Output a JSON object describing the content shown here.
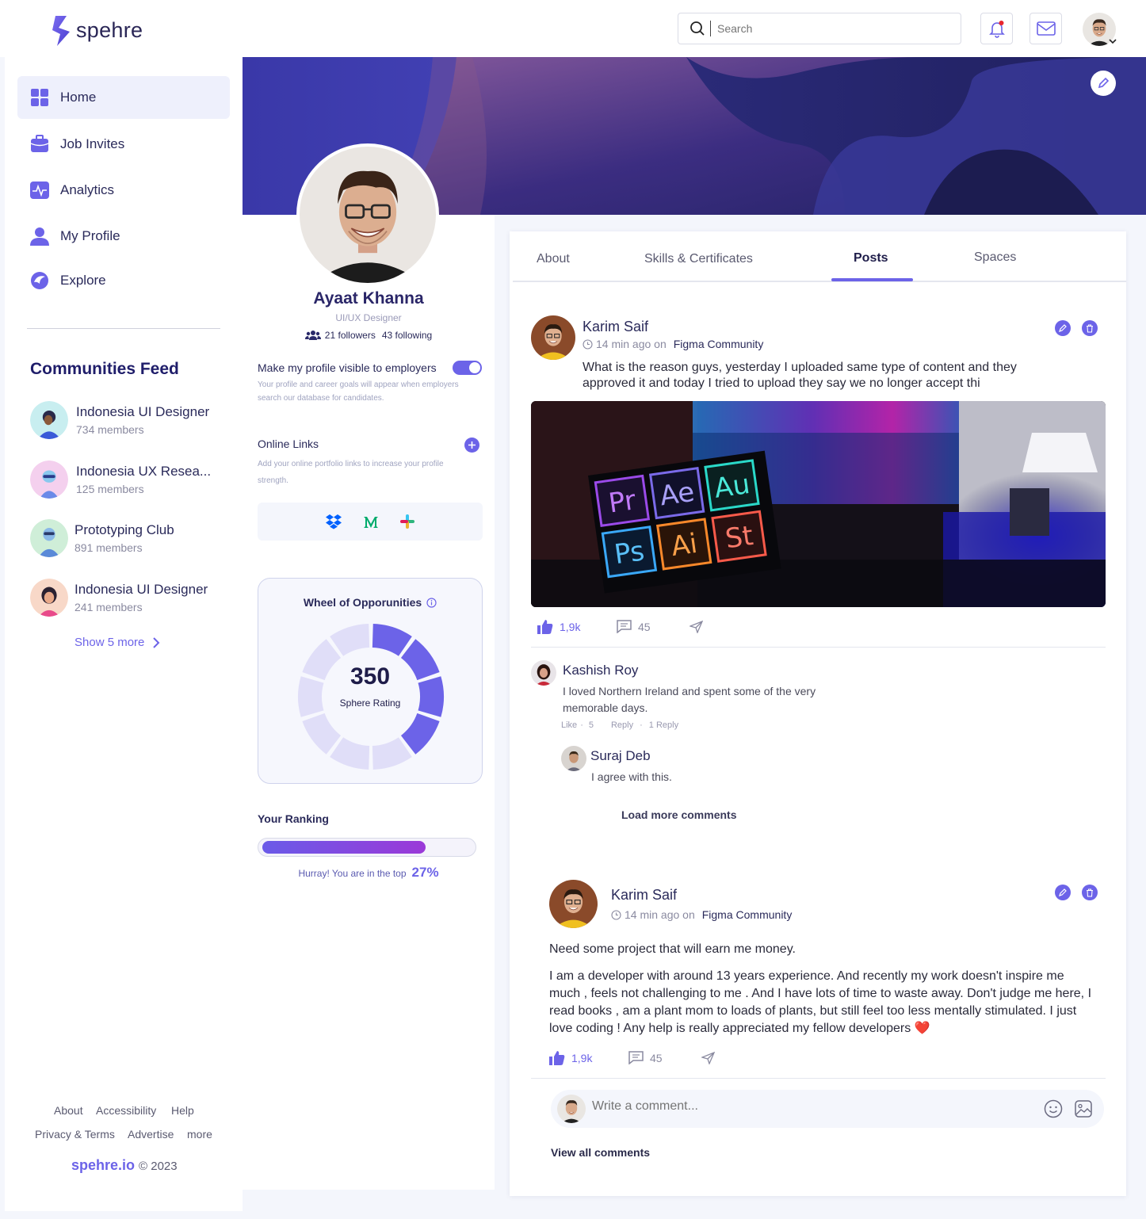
{
  "brand": {
    "name": "spehre",
    "accent": "#6c63e8"
  },
  "header": {
    "search_placeholder": "Search",
    "icons": [
      "search-icon",
      "bell-icon",
      "mail-icon",
      "avatar"
    ]
  },
  "sidebar": {
    "items": [
      {
        "label": "Home",
        "icon": "grid-icon",
        "active": true
      },
      {
        "label": "Job Invites",
        "icon": "briefcase-icon"
      },
      {
        "label": "Analytics",
        "icon": "pulse-icon"
      },
      {
        "label": "My Profile",
        "icon": "user-icon"
      },
      {
        "label": "Explore",
        "icon": "compass-icon"
      }
    ],
    "communities_title": "Communities Feed",
    "communities": [
      {
        "name": "Indonesia UI Designer",
        "members": "734 members"
      },
      {
        "name": "Indonesia UX Resea...",
        "members": "125 members"
      },
      {
        "name": "Prototyping Club",
        "members": "891 members"
      },
      {
        "name": "Indonesia UI Designer",
        "members": "241 members"
      }
    ],
    "show_more": "Show 5 more",
    "footer": {
      "links_row1": [
        "About",
        "Accessibility",
        "Help"
      ],
      "links_row2": [
        "Privacy & Terms",
        "Advertise",
        "more"
      ],
      "brand_link": "spehre.io",
      "copyright": "© 2023"
    }
  },
  "profile": {
    "name": "Ayaat Khanna",
    "role": "UI/UX Designer",
    "followers": "21 followers",
    "following": "43 following",
    "visibility_title": "Make my profile visible to employers",
    "visibility_desc": "Your profile and career goals will appear when employers search our database for candidates.",
    "visibility_on": true,
    "links_title": "Online Links",
    "links_desc": "Add your online portfolio links to increase your profile strength.",
    "link_icons": [
      "dropbox-icon",
      "medium-icon",
      "slack-icon"
    ],
    "wheel_title": "Wheel of Opporunities",
    "rating_value": "350",
    "rating_label": "Sphere Rating",
    "rating_fraction": 0.4,
    "ranking_title": "Your Ranking",
    "ranking_fraction": 0.75,
    "ranking_text": "Hurray! You are in the top",
    "ranking_percent": "27%"
  },
  "tabs": [
    "About",
    "Skills & Certificates",
    "Posts",
    "Spaces"
  ],
  "active_tab": "Posts",
  "posts": [
    {
      "author": "Karim Saif",
      "time": "14 min ago on",
      "community": "Figma Community",
      "text": "What is the reason guys, yesterday I uploaded same type of content and they approved it and today I tried to upload they say we no longer accept thi",
      "image_tiles": [
        "Pr",
        "Ae",
        "Au",
        "Ps",
        "Ai",
        "St"
      ],
      "likes": "1,9k",
      "comments": "45",
      "comment_list": [
        {
          "author": "Kashish Roy",
          "text": "I loved Northern Ireland and spent some of the very memorable days.",
          "like": "Like",
          "likes": "5",
          "reply": "Reply",
          "replies": "1 Reply"
        }
      ],
      "reply": {
        "author": "Suraj Deb",
        "text": "I agree with this."
      },
      "load_more": "Load more comments"
    },
    {
      "author": "Karim Saif",
      "time": "14 min ago on",
      "community": "Figma Community",
      "title": "Need some project that will earn me money.",
      "text": "I am a developer with around 13 years experience. And recently my work doesn't inspire me much , feels not challenging to me . And I have lots of time to waste away. Don't judge me here, I read books , am a plant mom to loads of plants, but still feel too less mentally stimulated. I just love coding ! Any help is really appreciated my fellow developers ❤️",
      "likes": "1,9k",
      "comments": "45",
      "comment_placeholder": "Write a comment...",
      "view_all": "View all comments"
    }
  ]
}
